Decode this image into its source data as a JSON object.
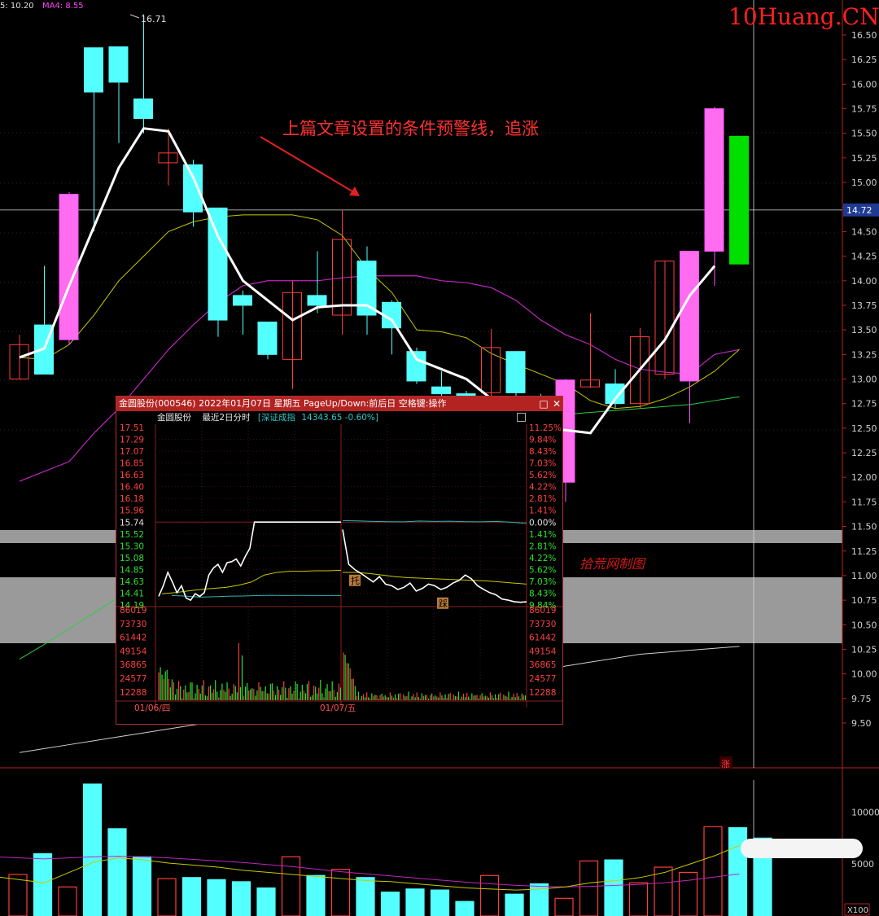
{
  "header": {
    "ma_label_1": "5: 10.20",
    "ma_label_2": "MA4: 8.55",
    "watermark": "10Huang.CN"
  },
  "annotations": {
    "arrow_text": "上篇文章设置的条件预警线，追涨",
    "stamp_text": "拾荒网制图",
    "high_label": "16.71",
    "zhang_tag": "涨",
    "price_tag": "14.72",
    "vol_unit": "X100"
  },
  "chart_data": [
    {
      "type": "candlestick",
      "title": "",
      "y_ticks": [
        "16.50",
        "16.25",
        "16.00",
        "15.75",
        "15.50",
        "15.25",
        "15.00",
        "14.75",
        "14.50",
        "14.25",
        "14.00",
        "13.75",
        "13.50",
        "13.25",
        "13.00",
        "12.75",
        "12.50",
        "12.25",
        "12.00",
        "11.75",
        "11.50",
        "11.25",
        "11.00",
        "10.75",
        "10.50",
        "10.25",
        "10.00",
        "9.75",
        "9.50"
      ],
      "ylim": [
        9.3,
        16.8
      ],
      "crosshair_price": 14.72,
      "candles": [
        {
          "o": 13.0,
          "h": 13.45,
          "l": 13.0,
          "c": 13.35
        },
        {
          "o": 13.55,
          "h": 14.15,
          "l": 13.05,
          "c": 13.05
        },
        {
          "o": 13.4,
          "h": 14.9,
          "l": 13.35,
          "c": 14.88
        },
        {
          "o": 16.37,
          "h": 16.37,
          "l": 14.5,
          "c": 15.92
        },
        {
          "o": 16.38,
          "h": 16.38,
          "l": 15.4,
          "c": 16.02
        },
        {
          "o": 15.85,
          "h": 16.71,
          "l": 15.5,
          "c": 15.65
        },
        {
          "o": 15.2,
          "h": 15.55,
          "l": 14.97,
          "c": 15.3
        },
        {
          "o": 15.18,
          "h": 15.23,
          "l": 14.55,
          "c": 14.7
        },
        {
          "o": 14.74,
          "h": 14.74,
          "l": 13.43,
          "c": 13.6
        },
        {
          "o": 13.85,
          "h": 13.9,
          "l": 13.45,
          "c": 13.75
        },
        {
          "o": 13.58,
          "h": 13.58,
          "l": 13.2,
          "c": 13.25
        },
        {
          "o": 13.2,
          "h": 14.0,
          "l": 12.9,
          "c": 13.88
        },
        {
          "o": 13.85,
          "h": 14.3,
          "l": 13.67,
          "c": 13.75
        },
        {
          "o": 13.65,
          "h": 14.72,
          "l": 13.45,
          "c": 14.42
        },
        {
          "o": 14.2,
          "h": 14.35,
          "l": 13.45,
          "c": 13.65
        },
        {
          "o": 13.78,
          "h": 13.8,
          "l": 13.25,
          "c": 13.52
        },
        {
          "o": 13.28,
          "h": 13.32,
          "l": 12.95,
          "c": 12.98
        },
        {
          "o": 12.92,
          "h": 13.08,
          "l": 12.6,
          "c": 12.85
        },
        {
          "o": 12.85,
          "h": 12.88,
          "l": 12.45,
          "c": 12.55
        },
        {
          "o": 12.86,
          "h": 13.51,
          "l": 12.8,
          "c": 13.32
        },
        {
          "o": 13.28,
          "h": 13.28,
          "l": 12.8,
          "c": 12.86
        },
        {
          "o": 12.8,
          "h": 12.85,
          "l": 12.45,
          "c": 12.5
        },
        {
          "o": 11.95,
          "h": 13.0,
          "l": 11.75,
          "c": 12.99
        },
        {
          "o": 12.92,
          "h": 13.67,
          "l": 12.91,
          "c": 12.99
        },
        {
          "o": 12.95,
          "h": 13.1,
          "l": 12.7,
          "c": 12.75
        },
        {
          "o": 12.75,
          "h": 13.52,
          "l": 12.7,
          "c": 13.43
        },
        {
          "o": 13.05,
          "h": 14.2,
          "l": 13.0,
          "c": 14.2
        },
        {
          "o": 12.98,
          "h": 14.3,
          "l": 12.55,
          "c": 14.3
        },
        {
          "o": 14.3,
          "h": 15.77,
          "l": 13.95,
          "c": 15.75
        },
        {
          "o": 15.47,
          "h": 15.47,
          "l": 14.17,
          "c": 14.17
        }
      ],
      "ma_white": [
        13.22,
        13.31,
        13.95,
        14.55,
        15.15,
        15.55,
        15.52,
        15.05,
        14.45,
        14.0,
        13.8,
        13.6,
        13.73,
        13.75,
        13.75,
        13.6,
        13.2,
        13.1,
        13.0,
        12.8,
        12.6,
        12.5,
        12.48,
        12.45,
        12.8,
        13.1,
        13.4,
        13.85,
        14.15
      ],
      "ma_yellow": [
        13.22,
        13.2,
        13.35,
        13.65,
        14.0,
        14.25,
        14.5,
        14.6,
        14.65,
        14.67,
        14.67,
        14.67,
        14.62,
        14.46,
        14.12,
        13.88,
        13.5,
        13.48,
        13.42,
        13.26,
        13.15,
        13.05,
        12.95,
        12.78,
        12.7,
        12.72,
        12.8,
        12.92,
        13.08,
        13.3
      ],
      "ma_magenta": [
        11.96,
        12.06,
        12.16,
        12.45,
        12.7,
        13.0,
        13.3,
        13.55,
        13.78,
        13.95,
        14.0,
        14.0,
        14.0,
        14.03,
        14.05,
        14.05,
        14.05,
        14.0,
        13.98,
        13.93,
        13.8,
        13.6,
        13.45,
        13.35,
        13.2,
        13.1,
        13.07,
        13.05,
        13.25,
        13.3
      ],
      "ma_green": [
        10.15,
        10.3,
        10.46,
        10.62,
        10.78,
        10.94,
        11.1,
        11.26,
        11.42,
        11.58,
        11.74,
        11.9,
        12.06,
        12.22,
        12.38,
        12.46,
        12.5,
        12.52,
        12.55,
        12.58,
        12.6,
        12.62,
        12.64,
        12.66,
        12.68,
        12.7,
        12.72,
        12.74,
        12.78,
        12.82
      ],
      "ma_grey": [
        9.2,
        9.24,
        9.28,
        9.32,
        9.36,
        9.4,
        9.44,
        9.48,
        9.52,
        9.56,
        9.6,
        9.64,
        9.68,
        9.72,
        9.76,
        9.8,
        9.84,
        9.88,
        9.92,
        9.96,
        10.0,
        10.04,
        10.08,
        10.12,
        10.16,
        10.2,
        10.22,
        10.24,
        10.26,
        10.28
      ]
    },
    {
      "type": "bar",
      "title": "",
      "y_ticks": [
        "10000",
        "5000"
      ],
      "ylim": [
        0,
        13500
      ],
      "values": [
        4000,
        6000,
        2800,
        12700,
        8400,
        5700,
        3600,
        3700,
        3500,
        3300,
        2700,
        5700,
        3900,
        4500,
        3700,
        2300,
        2600,
        2500,
        1400,
        3900,
        2100,
        3100,
        1700,
        5300,
        5400,
        3200,
        4700,
        4200,
        8600,
        8500,
        7500
      ],
      "ma_yellow": [
        3800,
        3500,
        3200,
        4200,
        5200,
        5600,
        5400,
        5100,
        4900,
        4700,
        4400,
        4200,
        4000,
        3800,
        3600,
        3400,
        3300,
        3100,
        2900,
        2700,
        2600,
        2500,
        2600,
        2800,
        3200,
        3400,
        3700,
        4200,
        5000,
        5800,
        6800
      ],
      "ma_magenta": [
        5700,
        5600,
        5500,
        5600,
        5700,
        5750,
        5700,
        5600,
        5450,
        5300,
        5150,
        4950,
        4750,
        4500,
        4250,
        4050,
        3850,
        3650,
        3450,
        3250,
        3100,
        2950,
        2850,
        2800,
        2850,
        2950,
        3050,
        3200,
        3450,
        3750,
        4050
      ]
    },
    {
      "type": "line",
      "title": "金圆股份(000546) 2022年01月07日 星期五 PageUp/Down:前后日 空格键:操作",
      "legend_name": "金圆股份",
      "subtitle_1": "最近2日分时",
      "subtitle_2": "[深证成指",
      "subtitle_3": "14343.65  -0.60%]",
      "price_ticks": [
        "17.51",
        "17.29",
        "17.07",
        "16.85",
        "16.63",
        "16.40",
        "16.18",
        "15.96",
        "15.74",
        "15.52",
        "15.30",
        "15.08",
        "14.85",
        "14.63",
        "14.41",
        "14.19"
      ],
      "pct_ticks": [
        "11.25%",
        "9.84%",
        "8.43%",
        "7.03%",
        "5.62%",
        "4.22%",
        "2.81%",
        "1.41%",
        "0.00%",
        "1.41%",
        "2.81%",
        "4.22%",
        "5.62%",
        "7.03%",
        "8.43%",
        "9.84%"
      ],
      "vol_ticks": [
        "86019",
        "73730",
        "61442",
        "49154",
        "36865",
        "24577",
        "12288"
      ],
      "ylim": [
        14.19,
        17.51
      ],
      "prev_close": 15.74,
      "x_labels": [
        "01/06/四",
        "01/07/五"
      ],
      "tags": [
        "托",
        "踩"
      ],
      "price_day1": [
        14.35,
        14.55,
        14.8,
        14.62,
        14.42,
        14.55,
        14.32,
        14.28,
        14.4,
        14.35,
        14.42,
        14.75,
        14.88,
        14.95,
        14.8,
        14.98,
        15.0,
        15.05,
        14.92,
        15.1,
        15.25,
        15.74,
        15.74,
        15.74,
        15.74,
        15.74,
        15.74,
        15.74,
        15.74,
        15.74,
        15.74,
        15.74,
        15.74,
        15.74,
        15.74,
        15.74,
        15.74,
        15.74,
        15.74,
        15.74,
        15.74
      ],
      "price_day2": [
        15.6,
        14.95,
        14.85,
        14.78,
        14.7,
        14.62,
        14.72,
        14.58,
        14.55,
        14.48,
        14.52,
        14.6,
        14.45,
        14.5,
        14.58,
        14.55,
        14.48,
        14.52,
        14.6,
        14.65,
        14.75,
        14.68,
        14.55,
        14.48,
        14.42,
        14.38,
        14.3,
        14.28,
        14.25,
        14.24,
        14.25
      ],
      "avg_day1": [
        14.4,
        14.42,
        14.45,
        14.48,
        14.5,
        14.52,
        14.56,
        14.62,
        14.75,
        14.8,
        14.82,
        14.82,
        14.83,
        14.83,
        14.84
      ],
      "avg_day2": [
        14.8,
        14.8,
        14.78,
        14.75,
        14.72,
        14.7,
        14.69,
        14.68,
        14.67,
        14.66,
        14.65,
        14.64,
        14.62,
        14.6,
        14.58
      ],
      "index_pct_day1": [
        -0.1,
        -0.2,
        -0.35,
        -0.3,
        -0.22,
        -0.18,
        -0.12,
        -0.08,
        -0.1,
        -0.09,
        -0.1,
        -0.11,
        -0.1
      ],
      "index_pct_day2": [
        0.05,
        0.02,
        -0.05,
        -0.08,
        -0.1,
        0.0,
        -0.05,
        -0.02,
        -0.08,
        -0.1,
        -0.05,
        -0.15,
        -0.3
      ]
    }
  ]
}
